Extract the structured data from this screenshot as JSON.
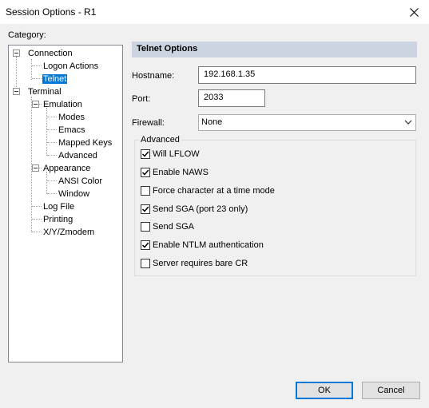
{
  "window": {
    "title": "Session Options - R1"
  },
  "category_label": "Category:",
  "tree": {
    "connection": "Connection",
    "logon_actions": "Logon Actions",
    "telnet": "Telnet",
    "terminal": "Terminal",
    "emulation": "Emulation",
    "modes": "Modes",
    "emacs": "Emacs",
    "mapped_keys": "Mapped Keys",
    "advanced": "Advanced",
    "appearance": "Appearance",
    "ansi_color": "ANSI Color",
    "window": "Window",
    "log_file": "Log File",
    "printing": "Printing",
    "xyzmodem": "X/Y/Zmodem"
  },
  "panel": {
    "header": "Telnet Options",
    "hostname_label": "Hostname:",
    "hostname_value": "192.168.1.35",
    "port_label": "Port:",
    "port_value": "2033",
    "firewall_label": "Firewall:",
    "firewall_value": "None",
    "advanced_label": "Advanced"
  },
  "options": [
    {
      "label": "Will LFLOW",
      "checked": true
    },
    {
      "label": "Enable NAWS",
      "checked": true
    },
    {
      "label": "Force character at a time mode",
      "checked": false
    },
    {
      "label": "Send SGA (port 23 only)",
      "checked": true
    },
    {
      "label": "Send SGA",
      "checked": false
    },
    {
      "label": "Enable NTLM authentication",
      "checked": true
    },
    {
      "label": "Server requires bare CR",
      "checked": false
    }
  ],
  "buttons": {
    "ok": "OK",
    "cancel": "Cancel"
  },
  "colors": {
    "selection": "#0078d7",
    "header_bg": "#cbd4e0"
  }
}
